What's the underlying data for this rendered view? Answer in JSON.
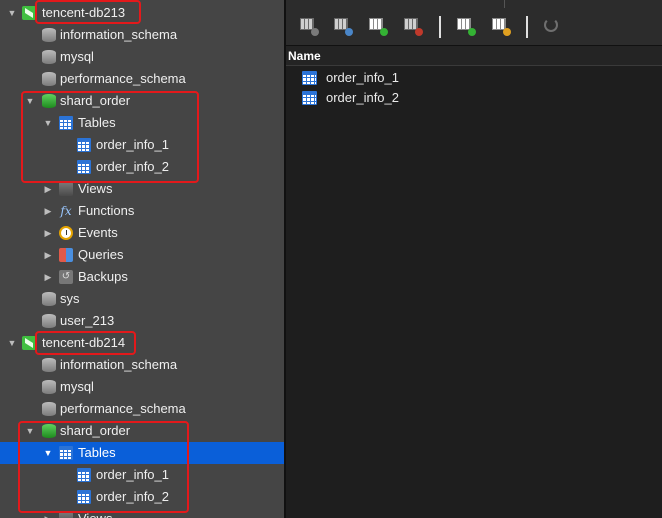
{
  "sidebar": {
    "servers": [
      {
        "name": "tencent-db213",
        "databases": [
          "information_schema",
          "mysql",
          "performance_schema"
        ],
        "open_database": {
          "name": "shard_order",
          "tables_label": "Tables",
          "tables": [
            "order_info_1",
            "order_info_2"
          ],
          "groups": [
            "Views",
            "Functions",
            "Events",
            "Queries",
            "Backups"
          ]
        },
        "more_databases": [
          "sys",
          "user_213"
        ]
      },
      {
        "name": "tencent-db214",
        "databases": [
          "information_schema",
          "mysql",
          "performance_schema"
        ],
        "open_database": {
          "name": "shard_order",
          "tables_label": "Tables",
          "tables": [
            "order_info_1",
            "order_info_2"
          ],
          "groups": [
            "Views"
          ]
        }
      }
    ],
    "selected_item": "Tables",
    "selection_color": "#0a5fd9"
  },
  "main": {
    "column_header": "Name",
    "objects": [
      "order_info_1",
      "order_info_2"
    ]
  },
  "toolbar": {
    "buttons": [
      "open-table-icon",
      "design-table-icon",
      "new-table-icon",
      "delete-table-icon",
      "import-wizard-icon",
      "export-wizard-icon",
      "refresh-icon"
    ]
  },
  "highlight_color": "#e3191b"
}
